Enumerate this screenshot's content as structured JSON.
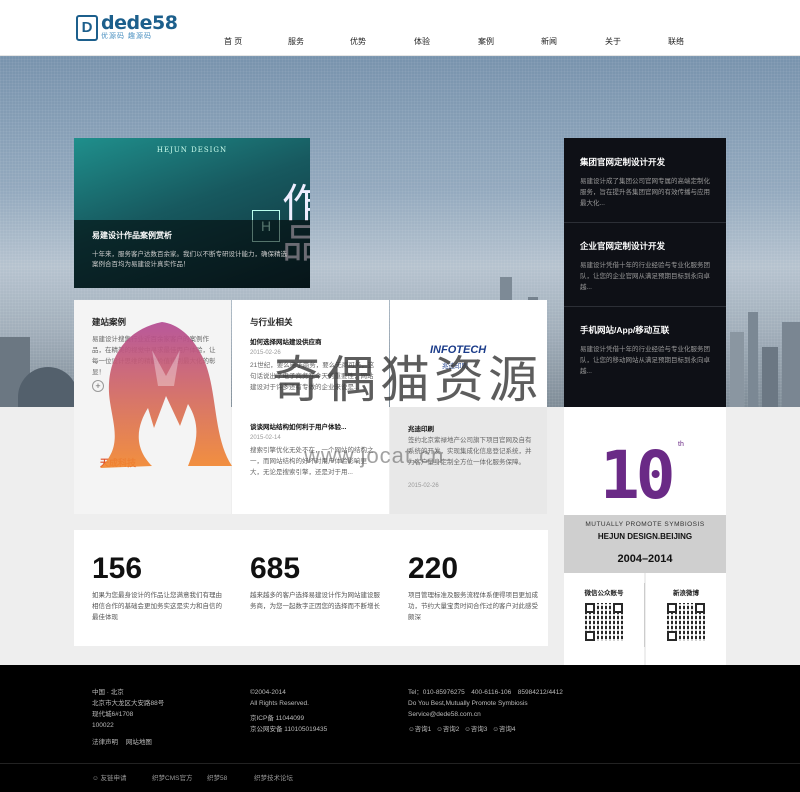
{
  "header": {
    "logo_name": "dede58",
    "logo_sub": "优源码 趣源码",
    "nav": [
      "首 页",
      "服务",
      "优势",
      "体验",
      "案例",
      "新闻",
      "关于",
      "联络"
    ]
  },
  "feature": {
    "top_text": "HEJUN DESIGN",
    "art_text": "作品",
    "title": "易建设计作品案例赏析",
    "desc": "十年来，服务客户达数百余家。我们以不断专研设计能力，确保精选案例合百均为易建设计真实作品！"
  },
  "services": [
    {
      "title": "集团官网定制设计开发",
      "desc": "易建设计成了集团公司官网专属的高端定制化服务，旨在提升各集团官网的有效传播与应用最大化..."
    },
    {
      "title": "企业官网定制设计开发",
      "desc": "易建设计凭借十年的行业经验与专业化服务团队，让您的企业官网从满足预期目标到永向卓越..."
    },
    {
      "title": "手机网站/App/移动互联",
      "desc": "易建设计凭借十年的行业经验与专业化服务团队，让您的移动网站从满足预期目标到永向卓越..."
    }
  ],
  "cases": {
    "title": "建站案例",
    "desc": "易建设计搜集行业近百余家客户的案例作品，在精美的视觉中寻求最佳用户体验，让每一位设计思维的精髓价值得到最大化的彰显！",
    "logo_text": "天成科技"
  },
  "industry": {
    "title": "与行业相关",
    "news": [
      {
        "title": "如何选择网站建设供应商",
        "date": "2015-02-26",
        "desc": "21世纪，要么电子商务，要么无商可务，这句话说出了电子商务在今天的重要性，网站建设对于许多还有专做的企业来说是..."
      },
      {
        "title": "谈谈网站结构如何利于用户体验...",
        "date": "2015-02-14",
        "desc": "搜索引擎优化无处不在，一个网站的结构之一，而网站结构的好坏对用户体验影响更大，无论是搜索引擎，还是对于用..."
      }
    ]
  },
  "partner": {
    "logo": "INFOTECH",
    "logo_sub": "兆迪印刷",
    "title": "兆迪印刷",
    "desc": "签约北京紫禄地产公司旗下项目官网及自有系统的开发，实现集成化信息登记系统，并为客户量身定制全方位一体化服务保障。",
    "date": "2015-02-26"
  },
  "stats": [
    {
      "num": "156",
      "desc": "如果为您最身设计的作品让您满意我们有理由相信合作的基础会更加务实这是实力和自信的最佳体现"
    },
    {
      "num": "685",
      "desc": "越来越多的客户选择易建设计作为网站建设服务商，为您一起数字正因您的选择而不断增长"
    },
    {
      "num": "220",
      "desc": "项目管理标准及服务流程体系便得项目更加成功，节约大量宝贵时间合作过的客户对此感受颇深"
    }
  ],
  "anniversary": {
    "big": "10",
    "sup": "th",
    "line1": "MUTUALLY PROMOTE SYMBIOSIS",
    "line2": "HEJUN DESIGN.BEIJING",
    "line3": "2004–2014"
  },
  "qr": [
    {
      "label": "微信公众账号"
    },
    {
      "label": "新浪微博"
    }
  ],
  "footer": {
    "col1": [
      "中国 · 北京",
      "北京市大龙区大安路88号",
      "现代城6#1708",
      "100022"
    ],
    "col1_links": [
      "法律声明",
      "网站地图"
    ],
    "col2": [
      "©2004-2014",
      "All Rights Reserved.",
      "京ICP备 11044099",
      "京公网安备 110105019435"
    ],
    "col3": [
      "Tel：010-85976275　400-6116-106　85984212/4412",
      "Do You Best,Mutually Promote Symbiosis",
      "Service@dede58.com.cn"
    ],
    "qq": [
      "咨询1",
      "咨询2",
      "咨询3",
      "咨询4"
    ],
    "links": [
      "友链申请",
      "织梦CMS官方",
      "织梦58",
      "织梦技术论坛"
    ]
  },
  "watermark": {
    "text": "奇偶猫资源",
    "url": "www.jocat.cn"
  }
}
